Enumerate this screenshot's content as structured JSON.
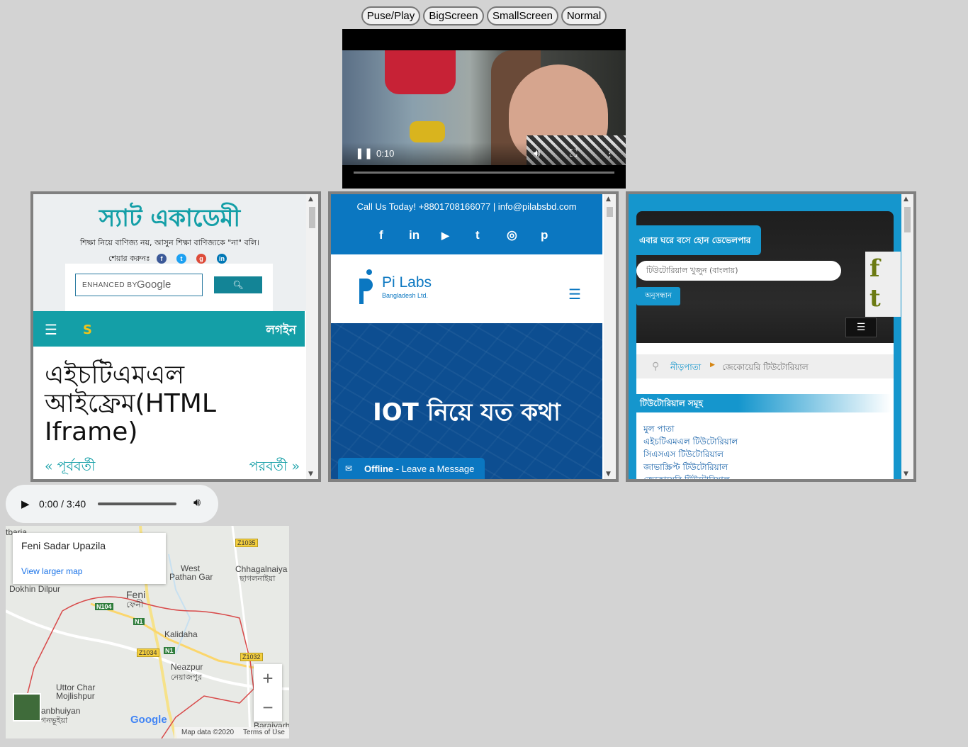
{
  "controls": {
    "pause_play": "Puse/Play",
    "big_screen": "BigScreen",
    "small_screen": "SmallScreen",
    "normal": "Normal"
  },
  "video": {
    "current_time": "0:10",
    "icons": [
      "pause-icon",
      "volume-icon",
      "fullscreen-icon",
      "more-options-icon"
    ]
  },
  "frame1": {
    "site_title": "স্যাট একাডেমী",
    "slogan": "শিক্ষা নিয়ে বাণিজ্য নয়, আসুন শিক্ষা বাণিজ্যকে \"না\" বলি।",
    "share_label": "শেয়ার করুনঃ",
    "search_label": "ENHANCED BY",
    "search_brand": "Google",
    "login": "লগইন",
    "heading": "এইচটিএমএল আইফ্রেম(HTML Iframe)",
    "prev": "« পূর্ববর্তী",
    "next": "পরবর্তী »"
  },
  "frame2": {
    "call": "Call Us Today! +8801708166077  |  info@pilabsbd.com",
    "social": [
      "f",
      "in",
      "▶",
      "t",
      "◎",
      "p"
    ],
    "brand_name": "Pi Labs",
    "brand_sub": "Bangladesh Ltd.",
    "hero_title": "IOT নিয়ে যত কথা",
    "offline_bold": "Offline",
    "offline_rest": " - Leave a Message"
  },
  "frame3": {
    "tagline": "এবার ঘরে বসে হোন ডেভেলপার",
    "search_placeholder": "টিউটোরিয়াল খুজুন (বাংলায়)",
    "search_button": "অনুসন্ধান",
    "breadcrumb_home": "নীড়পাতা",
    "breadcrumb_current": "জেকোয়েরি টিউটোরিয়াল",
    "section_title": "টিউটোরিয়াল সমূহ",
    "links": [
      "মুল পাতা",
      "এইচটিএমএল টিউটোরিয়াল",
      "সিএসএস টিউটোরিয়াল",
      "জাভাস্ক্রিপ্ট টিউটোরিয়াল",
      "জেকোয়েরি টিউটোরিয়াল"
    ]
  },
  "audio": {
    "time": "0:00 / 3:40"
  },
  "map": {
    "place_name": "Feni Sadar Upazila",
    "view_larger": "View larger map",
    "labels": {
      "tbaria": "tbaria",
      "west": "West",
      "pathan_gar": "Pathan Gar",
      "chhagalnaiya": "Chhagalnaiya",
      "chhagalnaiya_bn": "ছাগলনাইয়া",
      "dokhin_dilpur": "Dokhin Dilpur",
      "feni": "Feni",
      "feni_bn": "ফেনী",
      "kalidaha": "Kalidaha",
      "neazpur": "Neazpur",
      "neazpur_bn": "নেয়াজপুর",
      "uttor_char": "Uttor Char",
      "mojlishpur": "Mojlishpur",
      "anbhuiyan": "anbhuiyan",
      "anbhuiyan_bn": "গনভূইয়া",
      "baraiyarh": "Baraiyarh"
    },
    "shields": {
      "z1035": "Z1035",
      "n104": "N104",
      "n1a": "N1",
      "z1034": "Z1034",
      "n1b": "N1",
      "z1032": "Z1032"
    },
    "google": "Google",
    "map_data": "Map data ©2020",
    "terms": "Terms of Use",
    "zoom_in": "+",
    "zoom_out": "−"
  }
}
